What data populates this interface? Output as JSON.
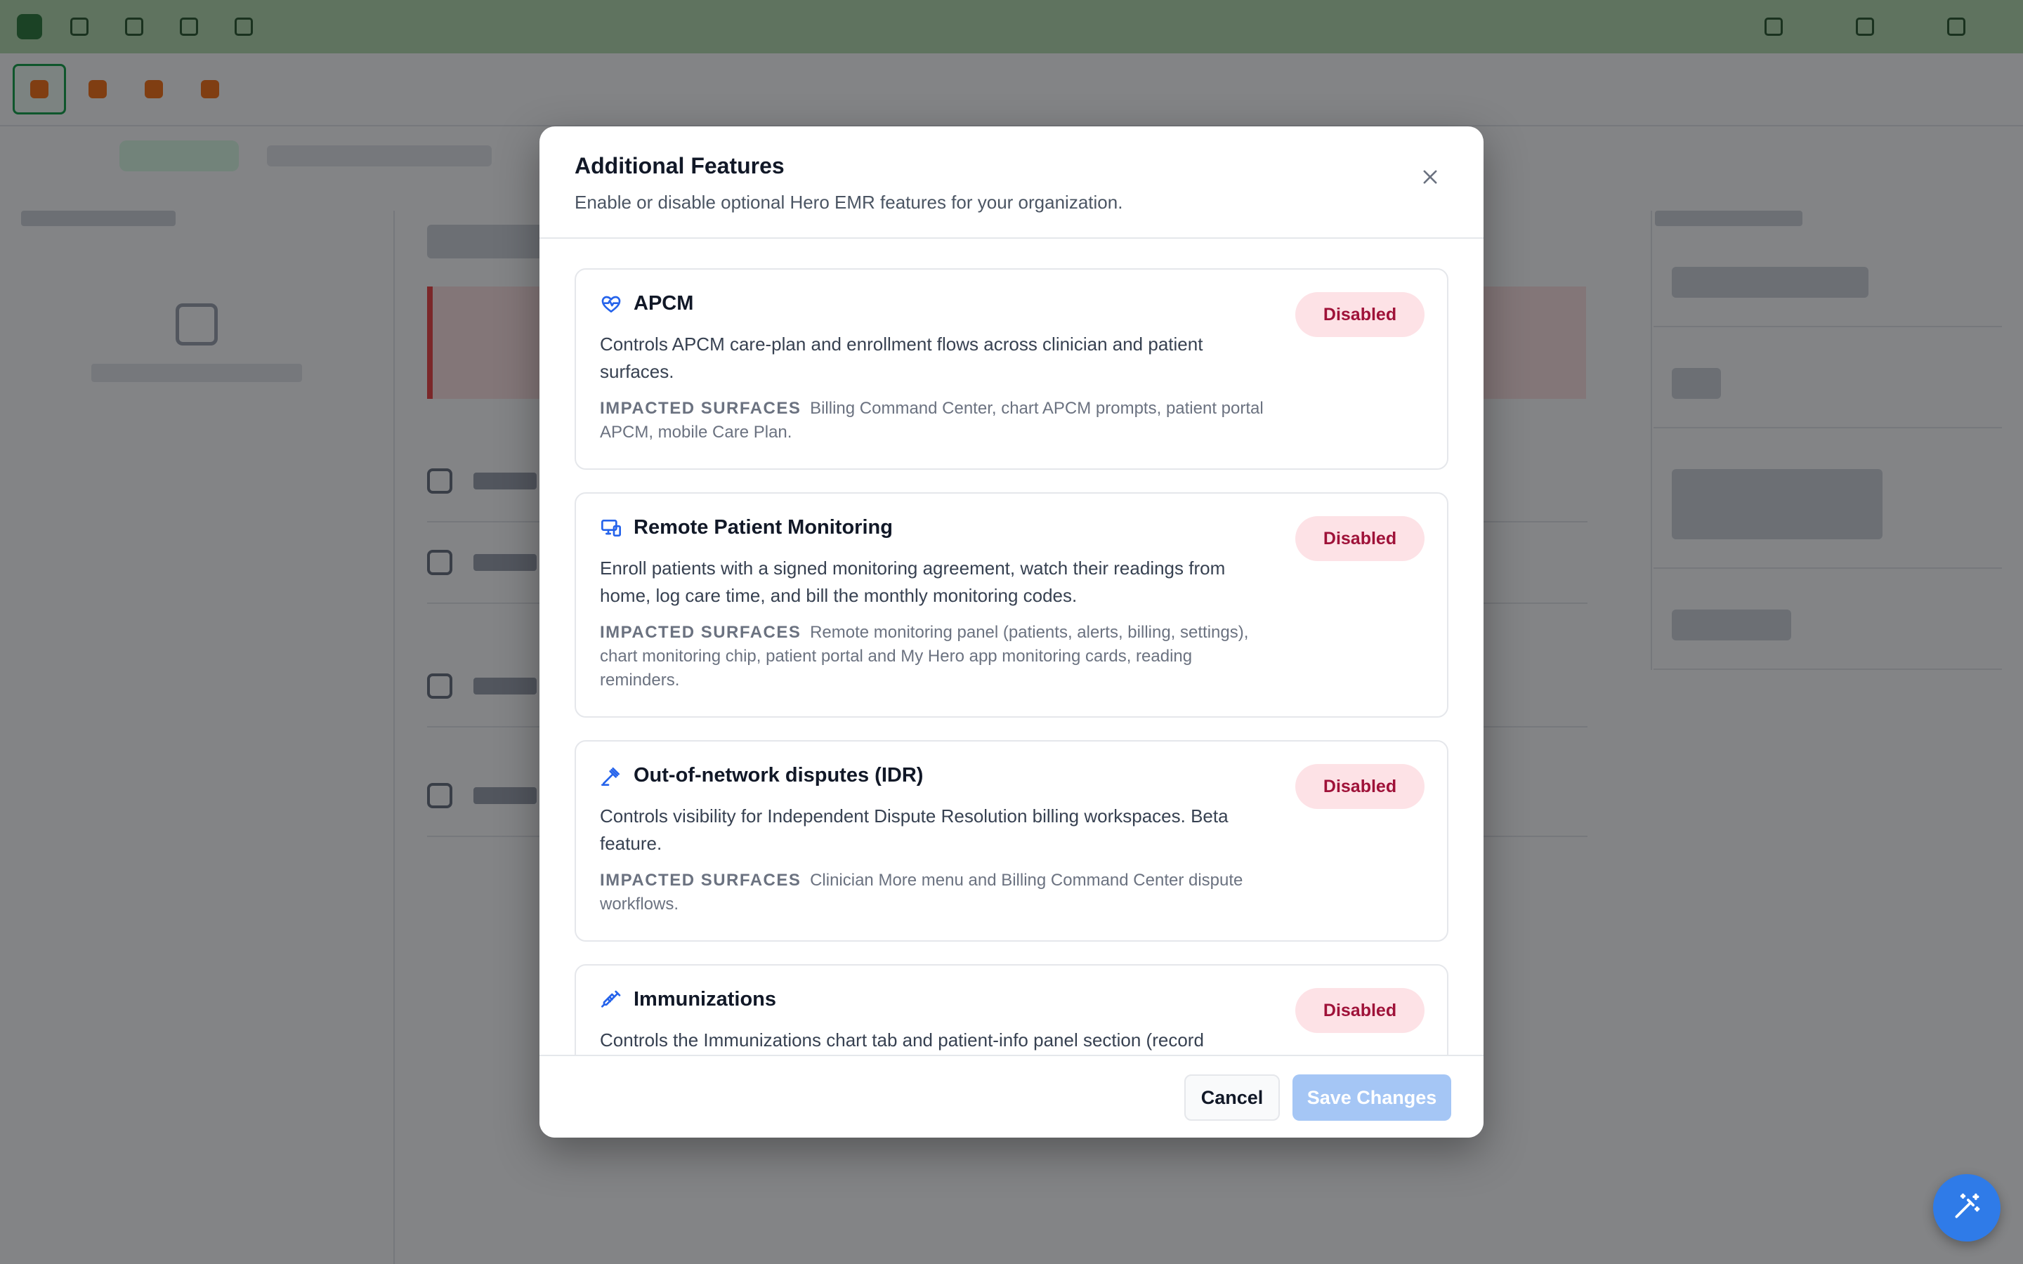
{
  "modal": {
    "title": "Additional Features",
    "subtitle": "Enable or disable optional Hero EMR features for your organization.",
    "impact_label": "IMPACTED SURFACES",
    "features": [
      {
        "name": "APCM",
        "icon": "heart-pulse-icon",
        "description": "Controls APCM care-plan and enrollment flows across clinician and patient surfaces.",
        "impacted": "Billing Command Center, chart APCM prompts, patient portal APCM, mobile Care Plan.",
        "status": "Disabled"
      },
      {
        "name": "Remote Patient Monitoring",
        "icon": "monitor-devices-icon",
        "description": "Enroll patients with a signed monitoring agreement, watch their readings from home, log care time, and bill the monthly monitoring codes.",
        "impacted": "Remote monitoring panel (patients, alerts, billing, settings), chart monitoring chip, patient portal and My Hero app monitoring cards, reading reminders.",
        "status": "Disabled"
      },
      {
        "name": "Out-of-network disputes (IDR)",
        "icon": "gavel-icon",
        "description": "Controls visibility for Independent Dispute Resolution billing workspaces. Beta feature.",
        "impacted": "Clinician More menu and Billing Command Center dispute workflows.",
        "status": "Disabled"
      },
      {
        "name": "Immunizations",
        "icon": "syringe-icon",
        "description": "Controls the Immunizations chart tab and patient-info panel section (record",
        "status": "Disabled"
      }
    ],
    "cancel_label": "Cancel",
    "save_label": "Save Changes"
  },
  "colors": {
    "accent": "#2f7be8",
    "disabled_pill_bg": "#fde2e6",
    "disabled_pill_text": "#9f1239",
    "feature_icon": "#2563eb",
    "overlay": "rgba(8,10,14,0.5)"
  }
}
